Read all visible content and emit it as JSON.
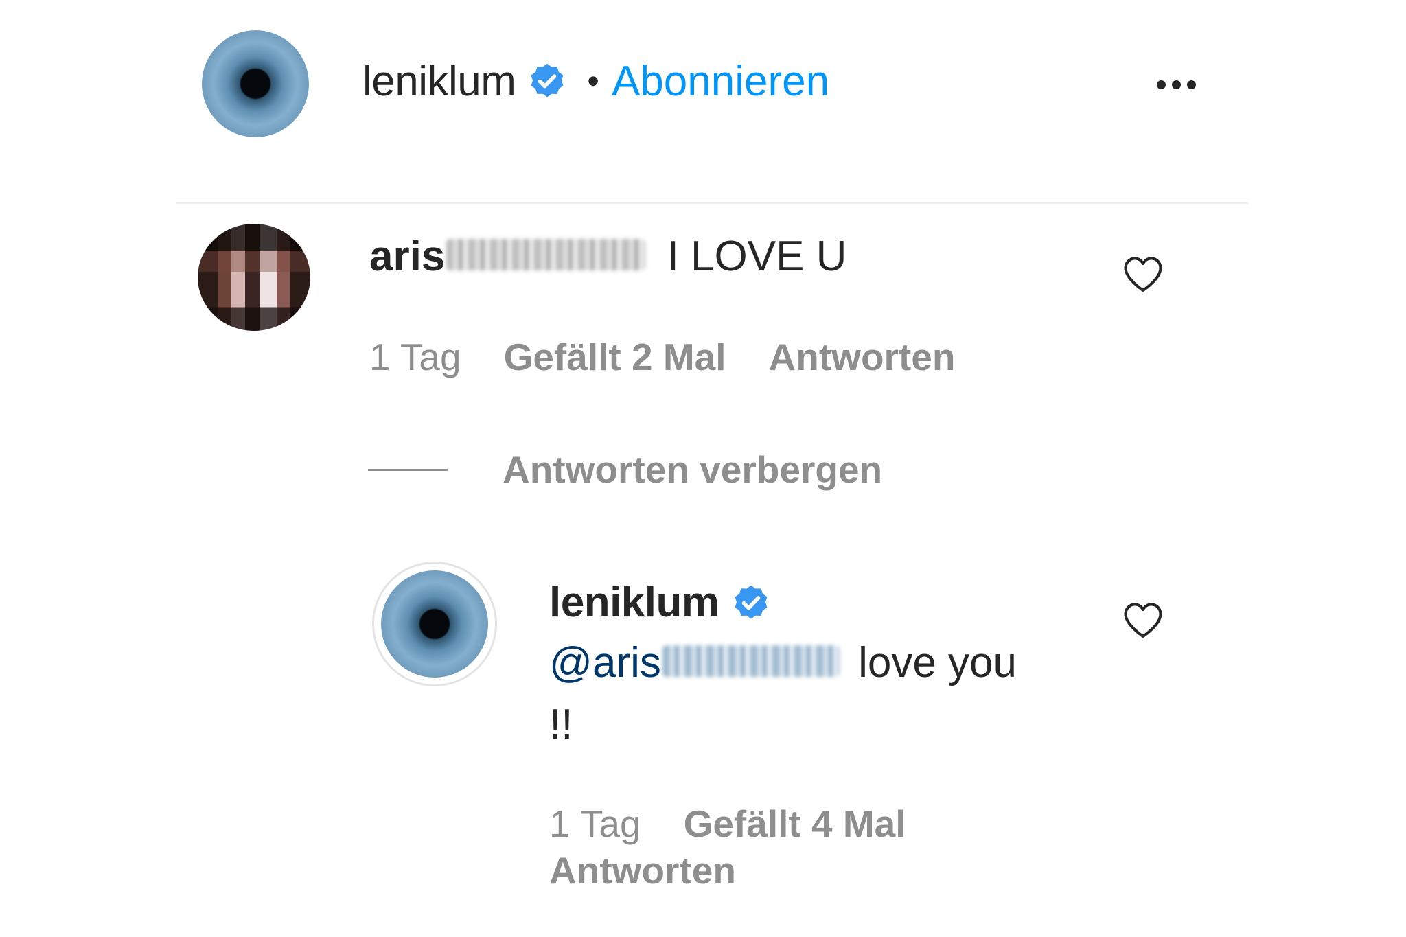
{
  "header": {
    "username": "leniklum",
    "separator": "•",
    "follow_label": "Abonnieren"
  },
  "comment": {
    "username_prefix": "aris",
    "text": "I LOVE U",
    "time": "1 Tag",
    "likes": "Gefällt 2 Mal",
    "reply_label": "Antworten",
    "hide_replies_label": "Antworten verbergen"
  },
  "reply": {
    "username": "leniklum",
    "mention_prefix": "@aris",
    "text": "love you",
    "text_line2": "!!",
    "time": "1 Tag",
    "likes": "Gefällt 4 Mal",
    "reply_label": "Antworten"
  },
  "colors": {
    "accent": "#0095f6",
    "verified": "#3897f0",
    "muted": "#8e8e8e",
    "text": "#262626"
  }
}
